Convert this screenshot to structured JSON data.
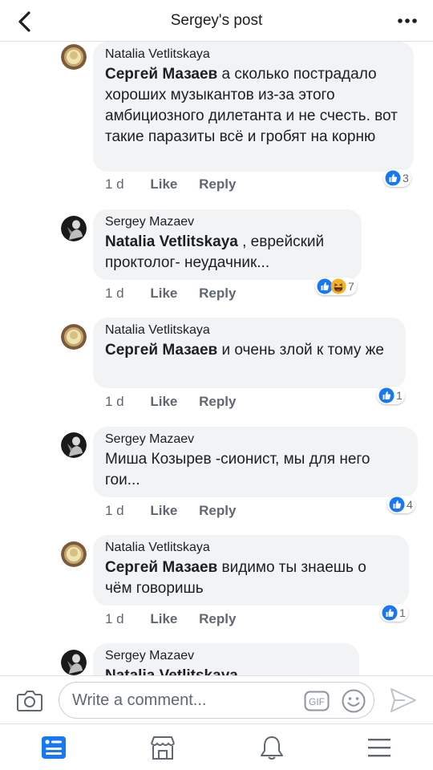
{
  "header": {
    "title": "Sergey's post",
    "back_icon": "chevron-left-icon",
    "more_icon": "more-dots-icon"
  },
  "comments": [
    {
      "author": "Natalia Vetlitskaya",
      "mention": "Сергей Мазаев",
      "text": " а сколько пострадало хороших музыкантов из-за этого амбициозного дилетанта  и не счесть. вот такие паразиты всё и гробят на корню",
      "time": "1 d",
      "like": "Like",
      "reply": "Reply",
      "reactions": [
        "like"
      ],
      "reaction_count": "3"
    },
    {
      "author": "Sergey Mazaev",
      "mention": "Natalia Vetlitskaya",
      "text": " , еврейский проктолог- неудачник...",
      "time": "1 d",
      "like": "Like",
      "reply": "Reply",
      "reactions": [
        "like",
        "haha"
      ],
      "reaction_count": "7"
    },
    {
      "author": "Natalia Vetlitskaya",
      "mention": "Сергей Мазаев",
      "text": " и очень злой к тому же",
      "time": "1 d",
      "like": "Like",
      "reply": "Reply",
      "reactions": [
        "like"
      ],
      "reaction_count": "1"
    },
    {
      "author": "Sergey Mazaev",
      "mention": "",
      "text": "Миша Козырев -сионист, мы для него гои...",
      "time": "1 d",
      "like": "Like",
      "reply": "Reply",
      "reactions": [
        "like"
      ],
      "reaction_count": "4"
    },
    {
      "author": "Natalia Vetlitskaya",
      "mention": "Сергей Мазаев",
      "text": " видимо ты знаешь о чём говоришь",
      "time": "1 d",
      "like": "Like",
      "reply": "Reply",
      "reactions": [
        "like"
      ],
      "reaction_count": "1"
    },
    {
      "author": "Sergey Mazaev",
      "mention": "Natalia Vetlitskaya",
      "text": " , ...",
      "time": "",
      "like": "",
      "reply": "",
      "reactions": [],
      "reaction_count": ""
    }
  ],
  "composer": {
    "placeholder": "Write a comment...",
    "gif_label": "GIF",
    "camera_icon": "camera-icon",
    "emoji_icon": "emoji-icon",
    "send_icon": "send-icon"
  },
  "nav": {
    "items": [
      "news-feed-icon",
      "marketplace-icon",
      "notifications-icon",
      "menu-icon"
    ],
    "active": "news-feed-icon"
  },
  "colors": {
    "brand": "#1877f2",
    "bubble": "#f2f3f5",
    "meta_text": "#606770",
    "divider": "#dddfe2"
  }
}
